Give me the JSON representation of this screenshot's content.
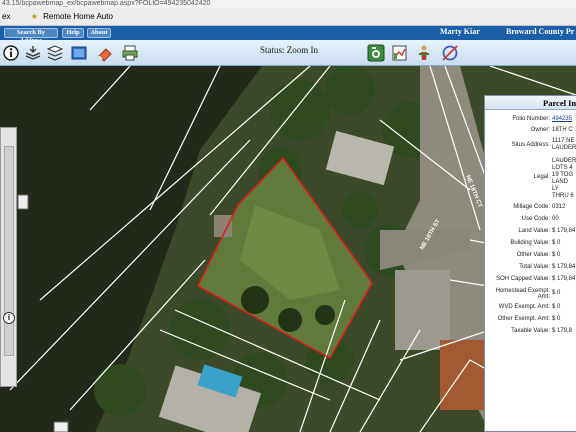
{
  "browser": {
    "url": "43.15/bcpawebmap_ex/bcpawebmap.aspx?FOLIO=494235042420",
    "tabs": [
      "ex",
      "Remote Home Auto"
    ]
  },
  "header": {
    "buttons": [
      "Search By Address",
      "Help",
      "About"
    ],
    "user": "Marty Kiar",
    "county": "Broward County Pr"
  },
  "toolbar": {
    "status": "Status: Zoom In",
    "icons": [
      "info-icon",
      "layers-icon",
      "stack-icon",
      "map-icon",
      "eraser-icon",
      "print-icon",
      "camera-icon",
      "chart-icon",
      "person-icon",
      "target-icon"
    ]
  },
  "map": {
    "street_labels": [
      "NE 18TH CT",
      "NE 18TH ST"
    ]
  },
  "parcel": {
    "title": "Parcel In",
    "rows": [
      {
        "label": "Folio Number:",
        "value": "494235",
        "link": true
      },
      {
        "label": "Owner:",
        "value": "18TH C"
      },
      {
        "label": "Situs Address:",
        "value": "1117 NE LAUDER"
      },
      {
        "label": "Legal:",
        "value": "LAUDER LOTS 4 19 TOG LAND LY THRU 6"
      },
      {
        "label": "Millage Code:",
        "value": "0312"
      },
      {
        "label": "Use Code:",
        "value": "00"
      },
      {
        "label": "Land Value:",
        "value": "$ 179,84"
      },
      {
        "label": "Building Value:",
        "value": "$ 0"
      },
      {
        "label": "Other Value:",
        "value": "$ 0"
      },
      {
        "label": "Total Value:",
        "value": "$ 179,84"
      },
      {
        "label": "SOH Capped Value:",
        "value": "$ 179,84"
      },
      {
        "label": "Homestead Exempt. Amt:",
        "value": "$ 0"
      },
      {
        "label": "WVD Exempt. Amt:",
        "value": "$ 0"
      },
      {
        "label": "Other Exempt. Amt:",
        "value": "$ 0"
      },
      {
        "label": "Taxable Value:",
        "value": "$ 179,8"
      }
    ]
  }
}
